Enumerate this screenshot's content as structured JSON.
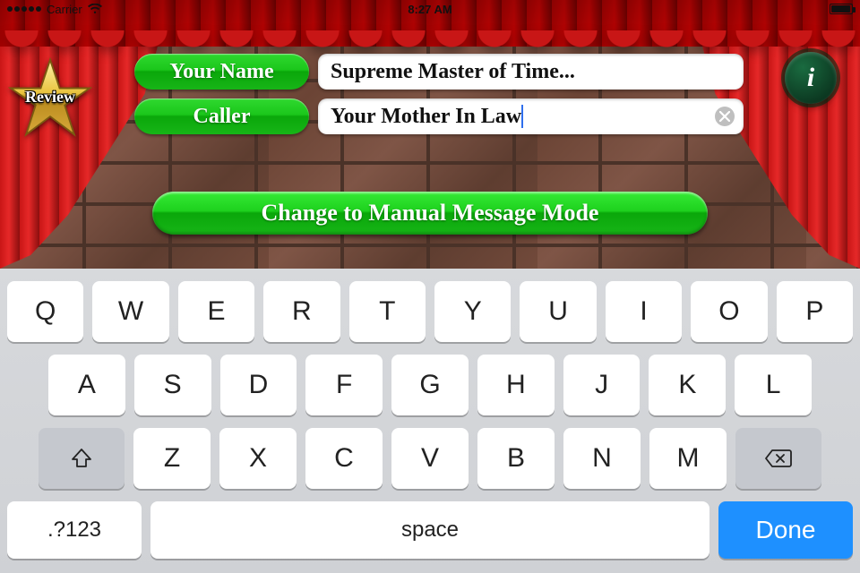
{
  "status": {
    "carrier": "Carrier",
    "time": "8:27 AM"
  },
  "review": {
    "label": "Review"
  },
  "info": {
    "glyph": "i"
  },
  "form": {
    "name_label": "Your Name",
    "name_value": "Supreme Master of Time...",
    "caller_label": "Caller",
    "caller_value": "Your Mother In Law"
  },
  "mode_button": {
    "label": "Change to Manual Message Mode"
  },
  "keyboard": {
    "row1": [
      "Q",
      "W",
      "E",
      "R",
      "T",
      "Y",
      "U",
      "I",
      "O",
      "P"
    ],
    "row2": [
      "A",
      "S",
      "D",
      "F",
      "G",
      "H",
      "J",
      "K",
      "L"
    ],
    "row3": [
      "Z",
      "X",
      "C",
      "V",
      "B",
      "N",
      "M"
    ],
    "symbols": ".?123",
    "space": "space",
    "done": "Done"
  }
}
